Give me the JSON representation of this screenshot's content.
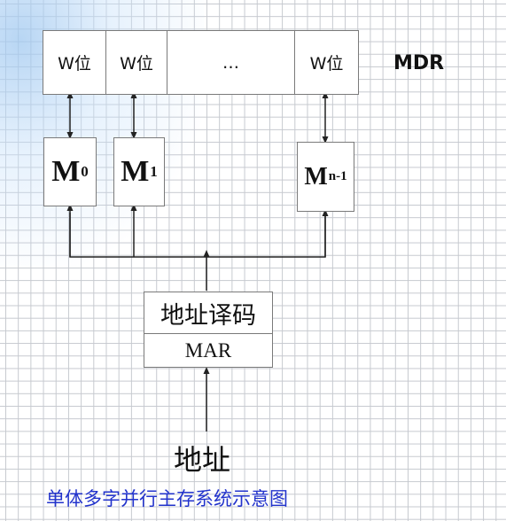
{
  "mdr": {
    "cells": [
      "W位",
      "W位",
      "…",
      "W位"
    ],
    "label": "MDR"
  },
  "memory_modules": [
    {
      "name": "M",
      "sub": "0"
    },
    {
      "name": "M",
      "sub": "1"
    },
    {
      "name": "M",
      "sub": "n-1"
    }
  ],
  "decoder": {
    "label": "地址译码"
  },
  "mar": {
    "label": "MAR"
  },
  "address": {
    "label": "地址"
  },
  "caption": "单体多字并行主存系统示意图"
}
